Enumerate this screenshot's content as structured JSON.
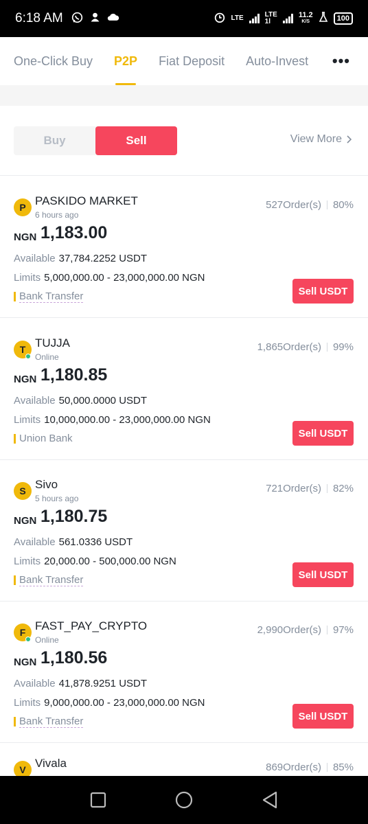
{
  "status_bar": {
    "time": "6:18 AM",
    "lte1": "LTE",
    "lte1_sub": "",
    "lte2": "LTE",
    "lte2_sub": "1l",
    "speed": "11.2",
    "speed_unit": "K/S",
    "battery": "100"
  },
  "tabs": [
    {
      "label": "One-Click Buy",
      "active": false
    },
    {
      "label": "P2P",
      "active": true
    },
    {
      "label": "Fiat Deposit",
      "active": false
    },
    {
      "label": "Auto-Invest",
      "active": false
    }
  ],
  "more_label": "•••",
  "toggle": {
    "buy": "Buy",
    "sell": "Sell",
    "selected": "Sell"
  },
  "view_more": "View More",
  "ads": [
    {
      "initial": "P",
      "merchant": "PASKIDO MARKET",
      "status": "6 hours ago",
      "orders": "527Order(s)",
      "completion": "80%",
      "currency": "NGN",
      "price": "1,183.00",
      "available_label": "Available",
      "available": "37,784.2252 USDT",
      "limits_label": "Limits",
      "limits": "5,000,000.00 - 23,000,000.00 NGN",
      "payment": "Bank Transfer",
      "action": "Sell USDT"
    },
    {
      "initial": "T",
      "merchant": "TUJJA",
      "status": "Online",
      "orders": "1,865Order(s)",
      "completion": "99%",
      "currency": "NGN",
      "price": "1,180.85",
      "available_label": "Available",
      "available": "50,000.0000 USDT",
      "limits_label": "Limits",
      "limits": "10,000,000.00 - 23,000,000.00 NGN",
      "payment": "Union Bank",
      "action": "Sell USDT"
    },
    {
      "initial": "S",
      "merchant": "Sivo",
      "status": "5 hours ago",
      "orders": "721Order(s)",
      "completion": "82%",
      "currency": "NGN",
      "price": "1,180.75",
      "available_label": "Available",
      "available": "561.0336 USDT",
      "limits_label": "Limits",
      "limits": "20,000.00 - 500,000.00 NGN",
      "payment": "Bank Transfer",
      "action": "Sell USDT"
    },
    {
      "initial": "F",
      "merchant": "FAST_PAY_CRYPTO",
      "status": "Online",
      "orders": "2,990Order(s)",
      "completion": "97%",
      "currency": "NGN",
      "price": "1,180.56",
      "available_label": "Available",
      "available": "41,878.9251 USDT",
      "limits_label": "Limits",
      "limits": "9,000,000.00 - 23,000,000.00 NGN",
      "payment": "Bank Transfer",
      "action": "Sell USDT"
    },
    {
      "initial": "V",
      "merchant": "Vivala",
      "orders": "869Order(s)",
      "completion": "85%"
    }
  ],
  "colors": {
    "accent": "#f0b90b",
    "sell": "#f6465d",
    "online": "#2ebd85",
    "muted": "#848e9c"
  }
}
